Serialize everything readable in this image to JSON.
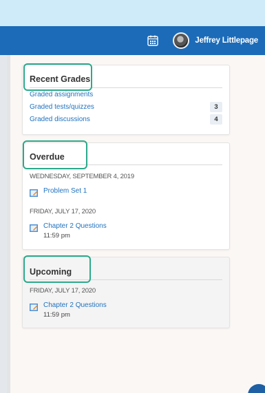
{
  "header": {
    "user_name": "Jeffrey Littlepage"
  },
  "recent_grades": {
    "title": "Recent Grades",
    "rows": [
      {
        "label": "Graded assignments",
        "count": ""
      },
      {
        "label": "Graded tests/quizzes",
        "count": "3"
      },
      {
        "label": "Graded discussions",
        "count": "4"
      }
    ]
  },
  "overdue": {
    "title": "Overdue",
    "groups": [
      {
        "date": "WEDNESDAY, SEPTEMBER 4, 2019",
        "item": "Problem Set 1",
        "time": ""
      },
      {
        "date": "FRIDAY, JULY 17, 2020",
        "item": "Chapter 2 Questions",
        "time": "11:59 pm"
      }
    ]
  },
  "upcoming": {
    "title": "Upcoming",
    "groups": [
      {
        "date": "FRIDAY, JULY 17, 2020",
        "item": "Chapter 2 Questions",
        "time": "11:59 pm"
      }
    ]
  },
  "colors": {
    "header_bg": "#1c6bb8",
    "link": "#1f72bf",
    "highlight": "#2aa98a"
  },
  "icons": [
    "calendar-icon",
    "avatar",
    "assignment-icon"
  ]
}
